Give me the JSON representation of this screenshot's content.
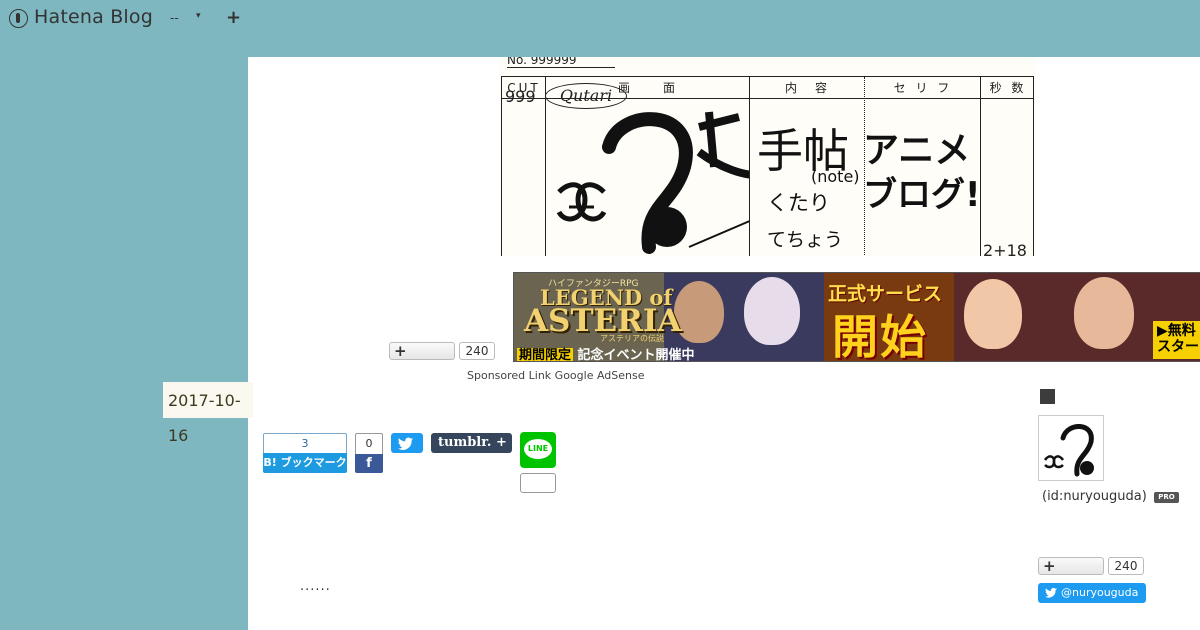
{
  "header": {
    "app_title": "Hatena Blog",
    "dash": "--",
    "caret": "▾",
    "plus": "+"
  },
  "header_image": {
    "number": "No. 999999",
    "columns": [
      "CUT",
      "画　　面",
      "内　容",
      "セ リ フ",
      "秒 数"
    ],
    "cut_no": "999",
    "logo_text": "Qutari",
    "big_note": "手帖",
    "note_en": "(note)",
    "kutari": "くたり",
    "techou": "てちょう",
    "anime_line1": "アニメ",
    "anime_line2": "ブログ!",
    "seconds": "2+18"
  },
  "ad": {
    "top_text": "ハイファンタジーRPG",
    "legend": "LEGEND of",
    "asteria": "ASTERIA",
    "subtitle": "アステリアの伝説",
    "event_hl": "期間限定",
    "event_rest": " 記念イベント開催中",
    "service": "正式サービス",
    "start": "開始",
    "cta": "▶無料\nスター"
  },
  "sponsored": "Sponsored Link Google AdSense",
  "subscribe": {
    "plus": "+",
    "count_left": "240",
    "count_right": "240"
  },
  "post": {
    "date_ym": "2017-10-",
    "date_day": "16",
    "ellipsis": "......"
  },
  "share": {
    "hatebu_count": "3",
    "hatebu_label": "B! ブックマーク",
    "fb_count": "0",
    "fb_label": "f",
    "tumblr_label": "tumblr. +",
    "line_label": "LINE",
    "line_count": ""
  },
  "sidebar": {
    "profile_id": "(id:nuryouguda)",
    "pro_badge": "PRO",
    "twitter_follow": "@nuryouguda"
  },
  "colors": {
    "background": "#7fb7c1",
    "twitter": "#1d9bf0",
    "facebook": "#3b5998",
    "hatebu": "#1e9be0",
    "tumblr": "#35465c",
    "line": "#00c300"
  }
}
